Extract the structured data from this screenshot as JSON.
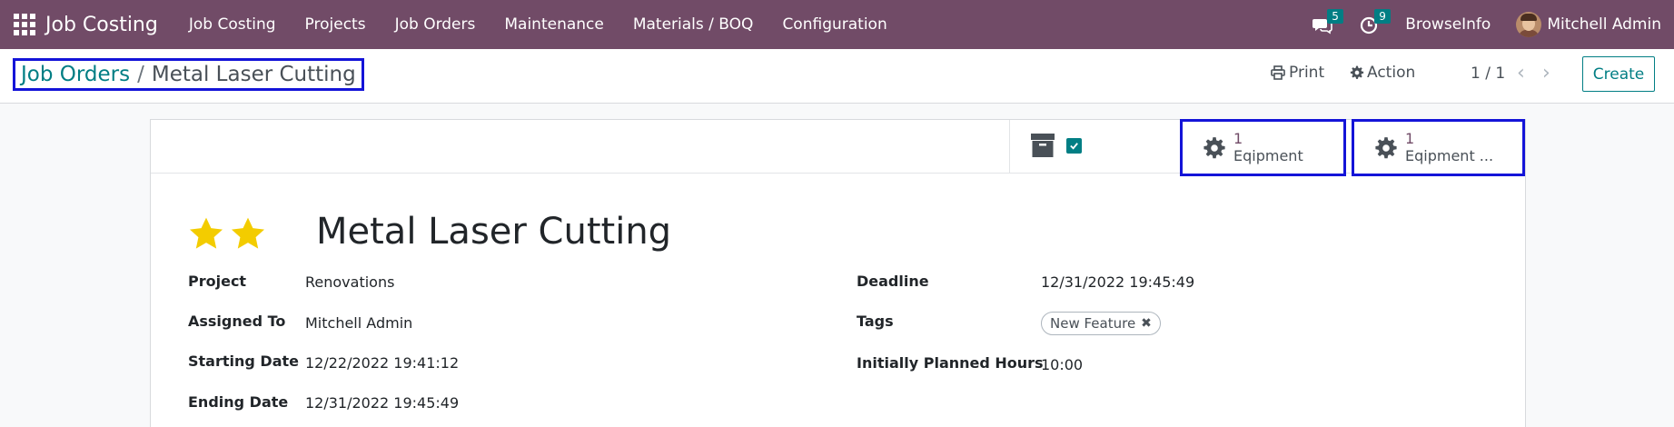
{
  "navbar": {
    "app_title": "Job Costing",
    "menu": [
      "Job Costing",
      "Projects",
      "Job Orders",
      "Maintenance",
      "Materials / BOQ",
      "Configuration"
    ],
    "messages_count": "5",
    "activities_count": "9",
    "company": "BrowseInfo",
    "user": "Mitchell Admin"
  },
  "control_panel": {
    "breadcrumb_parent": "Job Orders",
    "breadcrumb_separator": "/",
    "breadcrumb_current": "Metal Laser Cutting",
    "print_label": "Print",
    "action_label": "Action",
    "pager": "1 / 1",
    "create_label": "Create"
  },
  "button_box": {
    "buttons": [
      {
        "value": "1",
        "label": "Eqipment"
      },
      {
        "value": "1",
        "label": "Eqipment ..."
      }
    ]
  },
  "record": {
    "priority_stars": 2,
    "title": "Metal Laser Cutting",
    "left_fields": [
      {
        "label": "Project",
        "value": "Renovations"
      },
      {
        "label": "Assigned To",
        "value": "Mitchell Admin"
      },
      {
        "label": "Starting Date",
        "value": "12/22/2022 19:41:12"
      },
      {
        "label": "Ending Date",
        "value": "12/31/2022 19:45:49"
      }
    ],
    "right_fields": [
      {
        "label": "Deadline",
        "value": "12/31/2022 19:45:49"
      },
      {
        "label": "Tags",
        "value": ""
      },
      {
        "label": "Initially Planned Hours",
        "value": "10:00"
      }
    ],
    "tags": [
      "New Feature"
    ]
  },
  "colors": {
    "navbar": "#714b67",
    "accent": "#017e84",
    "star": "#f3cc00",
    "highlight_box": "#1414d8"
  }
}
